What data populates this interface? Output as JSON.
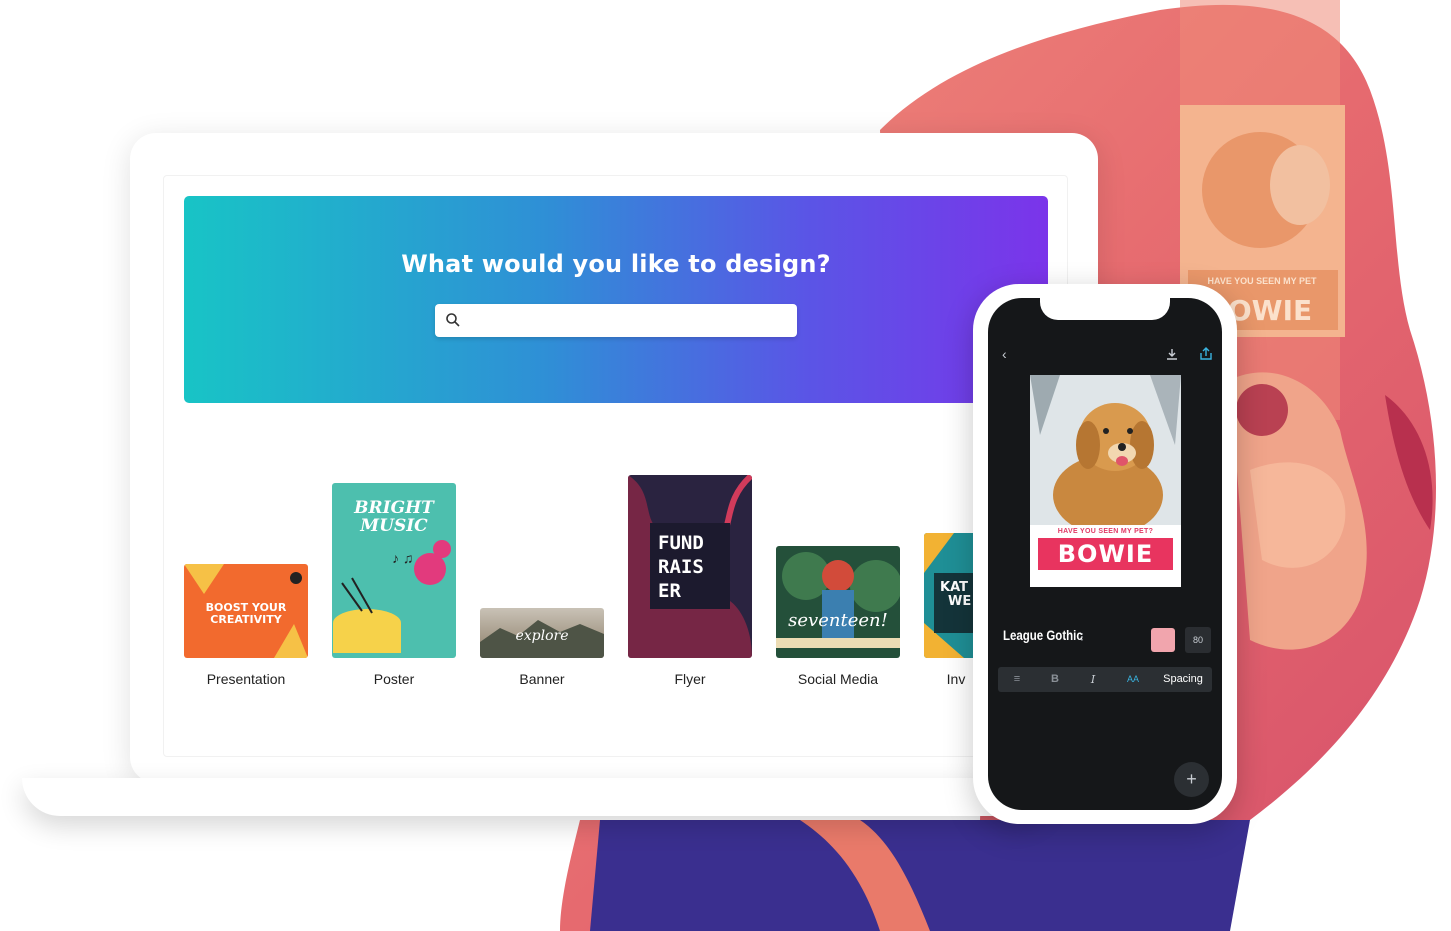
{
  "hero": {
    "title": "What would you like to design?",
    "search_placeholder": ""
  },
  "categories": [
    {
      "label": "Presentation",
      "thumb_lines": [
        "BOOST YOUR",
        "CREATIVITY"
      ]
    },
    {
      "label": "Poster",
      "thumb_lines": [
        "BRIGHT",
        "MUSIC"
      ]
    },
    {
      "label": "Banner",
      "thumb_lines": [
        "explore"
      ]
    },
    {
      "label": "Flyer",
      "thumb_lines": [
        "FUND",
        "RAIS",
        "ER"
      ]
    },
    {
      "label": "Social Media",
      "thumb_lines": [
        "seventeen!"
      ]
    },
    {
      "label": "Inv",
      "thumb_lines": [
        "KAT",
        "WE"
      ]
    }
  ],
  "phone": {
    "poster_subtitle": "HAVE YOU SEEN MY PET?",
    "poster_name": "BOWIE",
    "font_name": "League Gothic",
    "font_size": "80",
    "toolbar": {
      "bold": "B",
      "italic": "I",
      "case": "AA",
      "spacing": "Spacing"
    },
    "fab": "+"
  },
  "background_poster": {
    "subtitle": "HAVE YOU SEEN MY PET",
    "name": "OWIE"
  },
  "colors": {
    "hero_start": "#18c4c6",
    "hero_end": "#7b34ea",
    "poster_accent": "#e8345f",
    "background_blob": "#e76a70"
  }
}
